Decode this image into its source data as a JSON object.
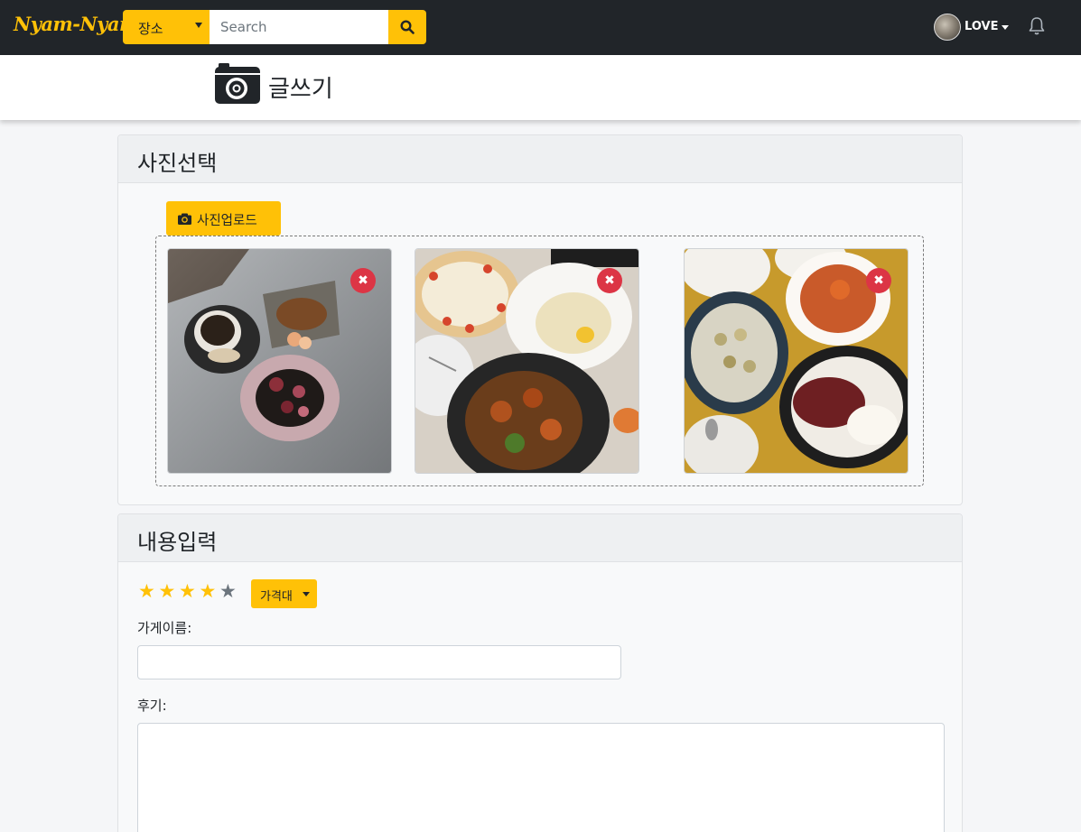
{
  "navbar": {
    "brand": "Nyam-Nyam",
    "location_select": "장소",
    "search_placeholder": "Search",
    "user_name": "LOVE"
  },
  "header": {
    "title": "글쓰기"
  },
  "photo_section": {
    "title": "사진선택",
    "upload_label": "사진업로드",
    "photos": [
      {
        "alt": "coffee-and-desserts-photo"
      },
      {
        "alt": "pizza-pasta-chicken-photo"
      },
      {
        "alt": "pasta-gnocchi-steak-photo"
      }
    ],
    "remove_label": "✖"
  },
  "content_section": {
    "title": "내용입력",
    "rating": 4,
    "rating_max": 5,
    "star_glyph": "★",
    "price_label": "가격대",
    "store_label": "가게이름:",
    "review_label": "후기:"
  },
  "colors": {
    "navbar": "#212529",
    "accent": "#ffc107",
    "danger": "#dc3545",
    "star_empty": "#6c757d"
  }
}
